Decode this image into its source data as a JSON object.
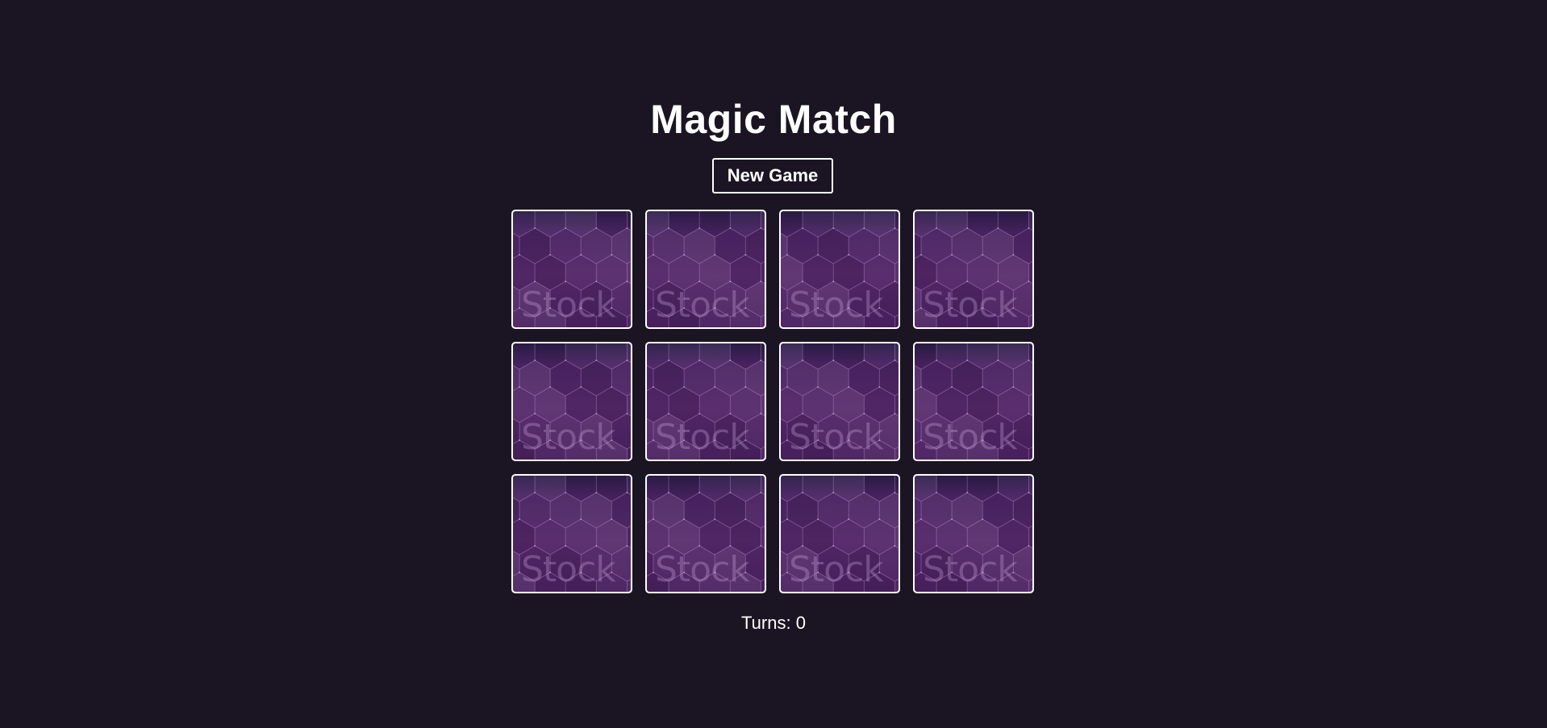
{
  "game": {
    "title": "Magic Match",
    "new_game_label": "New Game",
    "turns_label": "Turns:",
    "turns": "0"
  },
  "card_back": {
    "watermark": "Stock",
    "icon": "hexagon-pattern",
    "face_down": true
  },
  "cards": [
    {
      "face_down": true
    },
    {
      "face_down": true
    },
    {
      "face_down": true
    },
    {
      "face_down": true
    },
    {
      "face_down": true
    },
    {
      "face_down": true
    },
    {
      "face_down": true
    },
    {
      "face_down": true
    },
    {
      "face_down": true
    },
    {
      "face_down": true
    },
    {
      "face_down": true
    },
    {
      "face_down": true
    }
  ],
  "colors": {
    "background": "#1b1523",
    "card_border": "#ffffff",
    "card_back": "#55286a",
    "text": "#ffffff"
  }
}
